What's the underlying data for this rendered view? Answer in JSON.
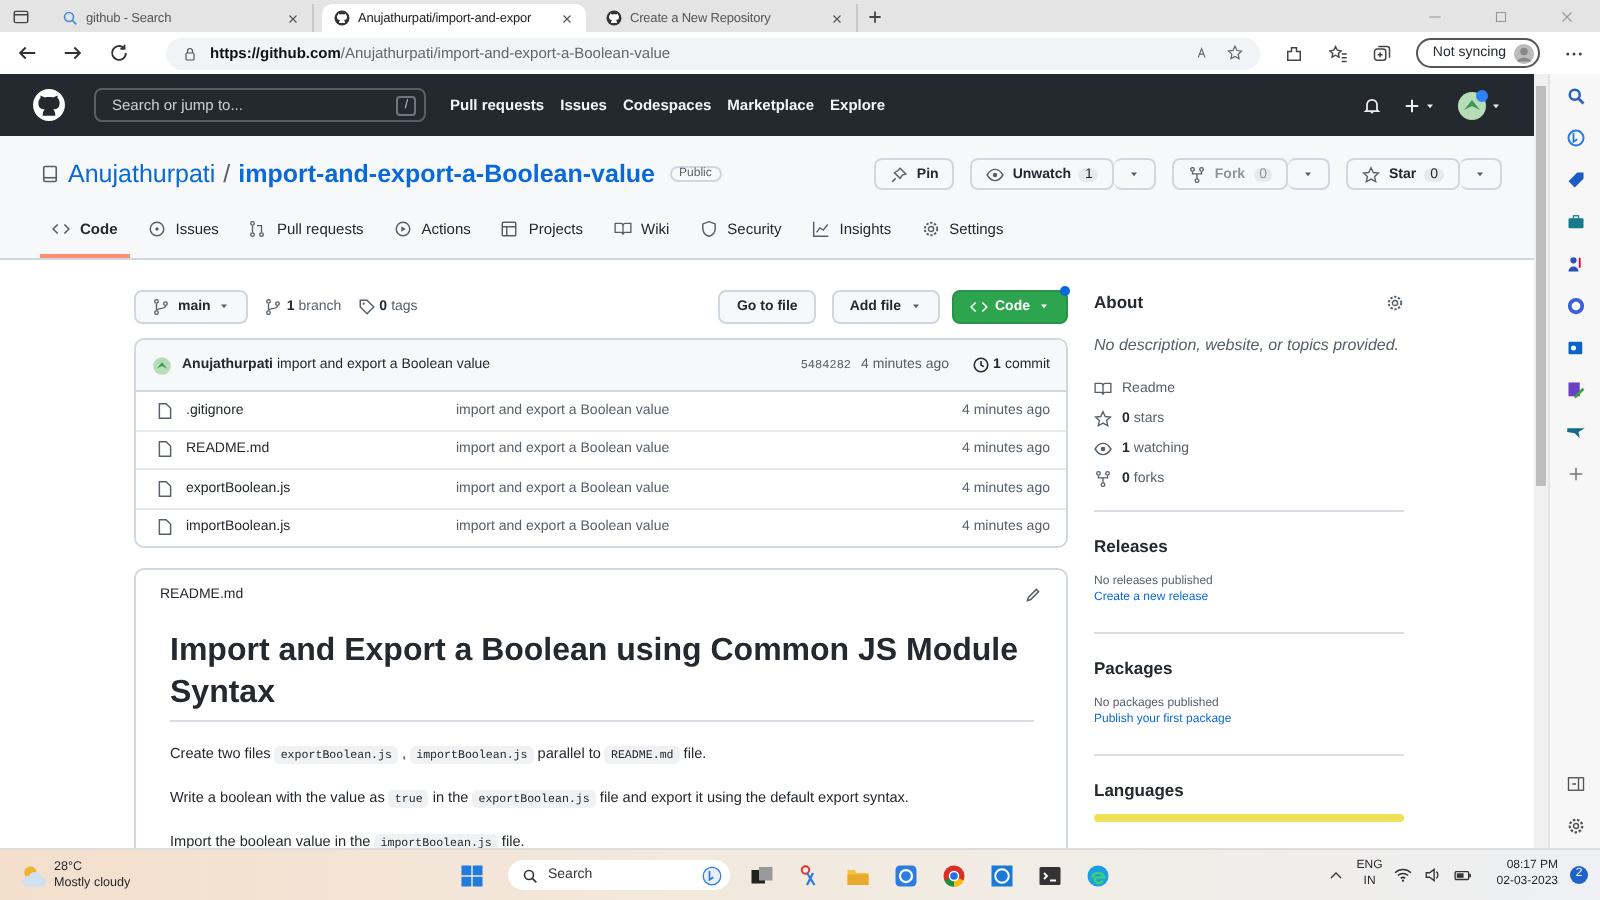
{
  "browser": {
    "tabs": [
      {
        "title": "github - Search",
        "selected": false,
        "kind": "search"
      },
      {
        "title": "Anujathurpati/import-and-expor",
        "selected": true,
        "kind": "github"
      },
      {
        "title": "Create a New Repository",
        "selected": false,
        "kind": "github"
      }
    ],
    "url_host": "https://github.com",
    "url_path": "/Anujathurpati/import-and-export-a-Boolean-value",
    "sync_button": "Not syncing"
  },
  "github_header": {
    "search_placeholder": "Search or jump to...",
    "shortcut": "/",
    "nav": [
      "Pull requests",
      "Issues",
      "Codespaces",
      "Marketplace",
      "Explore"
    ]
  },
  "repo": {
    "owner": "Anujathurpati",
    "separator": "/",
    "name": "import-and-export-a-Boolean-value",
    "visibility": "Public",
    "actions": [
      {
        "label": "Pin",
        "kind": "pin",
        "disabled": false
      },
      {
        "label": "Unwatch",
        "count": "1",
        "kind": "eye",
        "disabled": false
      },
      {
        "label": "Fork",
        "count": "0",
        "kind": "fork",
        "disabled": true
      },
      {
        "label": "Star",
        "count": "0",
        "kind": "star",
        "disabled": false
      }
    ],
    "tabs": [
      {
        "label": "Code",
        "kind": "code",
        "selected": true
      },
      {
        "label": "Issues",
        "kind": "issue",
        "selected": false
      },
      {
        "label": "Pull requests",
        "kind": "pr",
        "selected": false
      },
      {
        "label": "Actions",
        "kind": "play",
        "selected": false
      },
      {
        "label": "Projects",
        "kind": "table",
        "selected": false
      },
      {
        "label": "Wiki",
        "kind": "book",
        "selected": false
      },
      {
        "label": "Security",
        "kind": "shield",
        "selected": false
      },
      {
        "label": "Insights",
        "kind": "graph",
        "selected": false
      },
      {
        "label": "Settings",
        "kind": "gear",
        "selected": false
      }
    ]
  },
  "code_bar": {
    "branch": "main",
    "branch_count": "1",
    "branch_label": "branch",
    "tag_count": "0",
    "tag_label": "tags",
    "buttons": [
      {
        "label": "Go to file",
        "kind": "plain"
      },
      {
        "label": "Add file",
        "kind": "menu"
      },
      {
        "label": "Code",
        "kind": "primary"
      }
    ]
  },
  "commit": {
    "author": "Anujathurpati",
    "message": "import and export a Boolean value",
    "hash": "5484282",
    "time": "4 minutes ago",
    "count": "1",
    "count_label": "commit"
  },
  "files": [
    {
      "name": ".gitignore",
      "message": "import and export a Boolean value",
      "time": "4 minutes ago"
    },
    {
      "name": "README.md",
      "message": "import and export a Boolean value",
      "time": "4 minutes ago"
    },
    {
      "name": "exportBoolean.js",
      "message": "import and export a Boolean value",
      "time": "4 minutes ago"
    },
    {
      "name": "importBoolean.js",
      "message": "import and export a Boolean value",
      "time": "4 minutes ago"
    }
  ],
  "readme": {
    "filename": "README.md",
    "heading": "Import and Export a Boolean using Common JS Module Syntax",
    "paragraphs": [
      [
        {
          "kind": "text",
          "text": "Create two files "
        },
        {
          "kind": "code",
          "text": "exportBoolean.js"
        },
        {
          "kind": "text",
          "text": " , "
        },
        {
          "kind": "code",
          "text": "importBoolean.js"
        },
        {
          "kind": "text",
          "text": " parallel to "
        },
        {
          "kind": "code",
          "text": "README.md"
        },
        {
          "kind": "text",
          "text": " file."
        }
      ],
      [
        {
          "kind": "text",
          "text": "Write a boolean with the value as "
        },
        {
          "kind": "code",
          "text": "true"
        },
        {
          "kind": "text",
          "text": " in the "
        },
        {
          "kind": "code",
          "text": "exportBoolean.js"
        },
        {
          "kind": "text",
          "text": " file and export it using the default export syntax."
        }
      ],
      [
        {
          "kind": "text",
          "text": "Import the boolean value in the "
        },
        {
          "kind": "code",
          "text": "importBoolean.js"
        },
        {
          "kind": "text",
          "text": " file."
        }
      ]
    ]
  },
  "about": {
    "title": "About",
    "description": "No description, website, or topics provided.",
    "items": [
      {
        "kind": "book",
        "label": "Readme"
      },
      {
        "kind": "star",
        "count": "0",
        "label": "stars"
      },
      {
        "kind": "eye",
        "count": "1",
        "label": "watching"
      },
      {
        "kind": "fork",
        "count": "0",
        "label": "forks"
      }
    ]
  },
  "sections": [
    {
      "title": "Releases",
      "note": "No releases published",
      "link": "Create a new release"
    },
    {
      "title": "Packages",
      "note": "No packages published",
      "link": "Publish your first package"
    },
    {
      "title": "Languages",
      "kind": "languages"
    }
  ],
  "taskbar": {
    "temperature": "28°C",
    "weather": "Mostly cloudy",
    "search_placeholder": "Search",
    "language": "ENG",
    "region": "IN",
    "time": "08:17 PM",
    "date": "02-03-2023",
    "notifications": "2"
  }
}
